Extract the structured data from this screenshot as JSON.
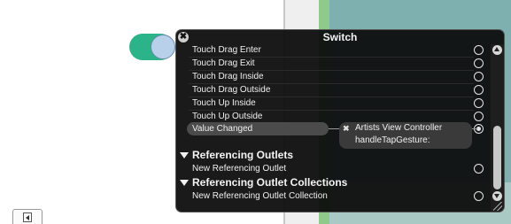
{
  "panel": {
    "title": "Switch",
    "close_glyph": "✖"
  },
  "events": [
    {
      "label": "Touch Drag Enter",
      "connected": false
    },
    {
      "label": "Touch Drag Exit",
      "connected": false
    },
    {
      "label": "Touch Drag Inside",
      "connected": false
    },
    {
      "label": "Touch Drag Outside",
      "connected": false
    },
    {
      "label": "Touch Up Inside",
      "connected": false
    },
    {
      "label": "Touch Up Outside",
      "connected": false
    },
    {
      "label": "Value Changed",
      "connected": true
    }
  ],
  "connection": {
    "remove_glyph": "✖",
    "target": "Artists View Controller",
    "action": "handleTapGesture:"
  },
  "sections": {
    "referencing_outlets": {
      "title": "Referencing Outlets",
      "new_item": "New Referencing Outlet"
    },
    "referencing_outlet_collections": {
      "title": "Referencing Outlet Collections",
      "new_item": "New Referencing Outlet Collection"
    }
  },
  "colors": {
    "switch_on": "#2bb38a",
    "hud_bg": "#0c0c0c",
    "canvas_teal": "#7fb0b0",
    "canvas_green": "#8fc98c"
  }
}
